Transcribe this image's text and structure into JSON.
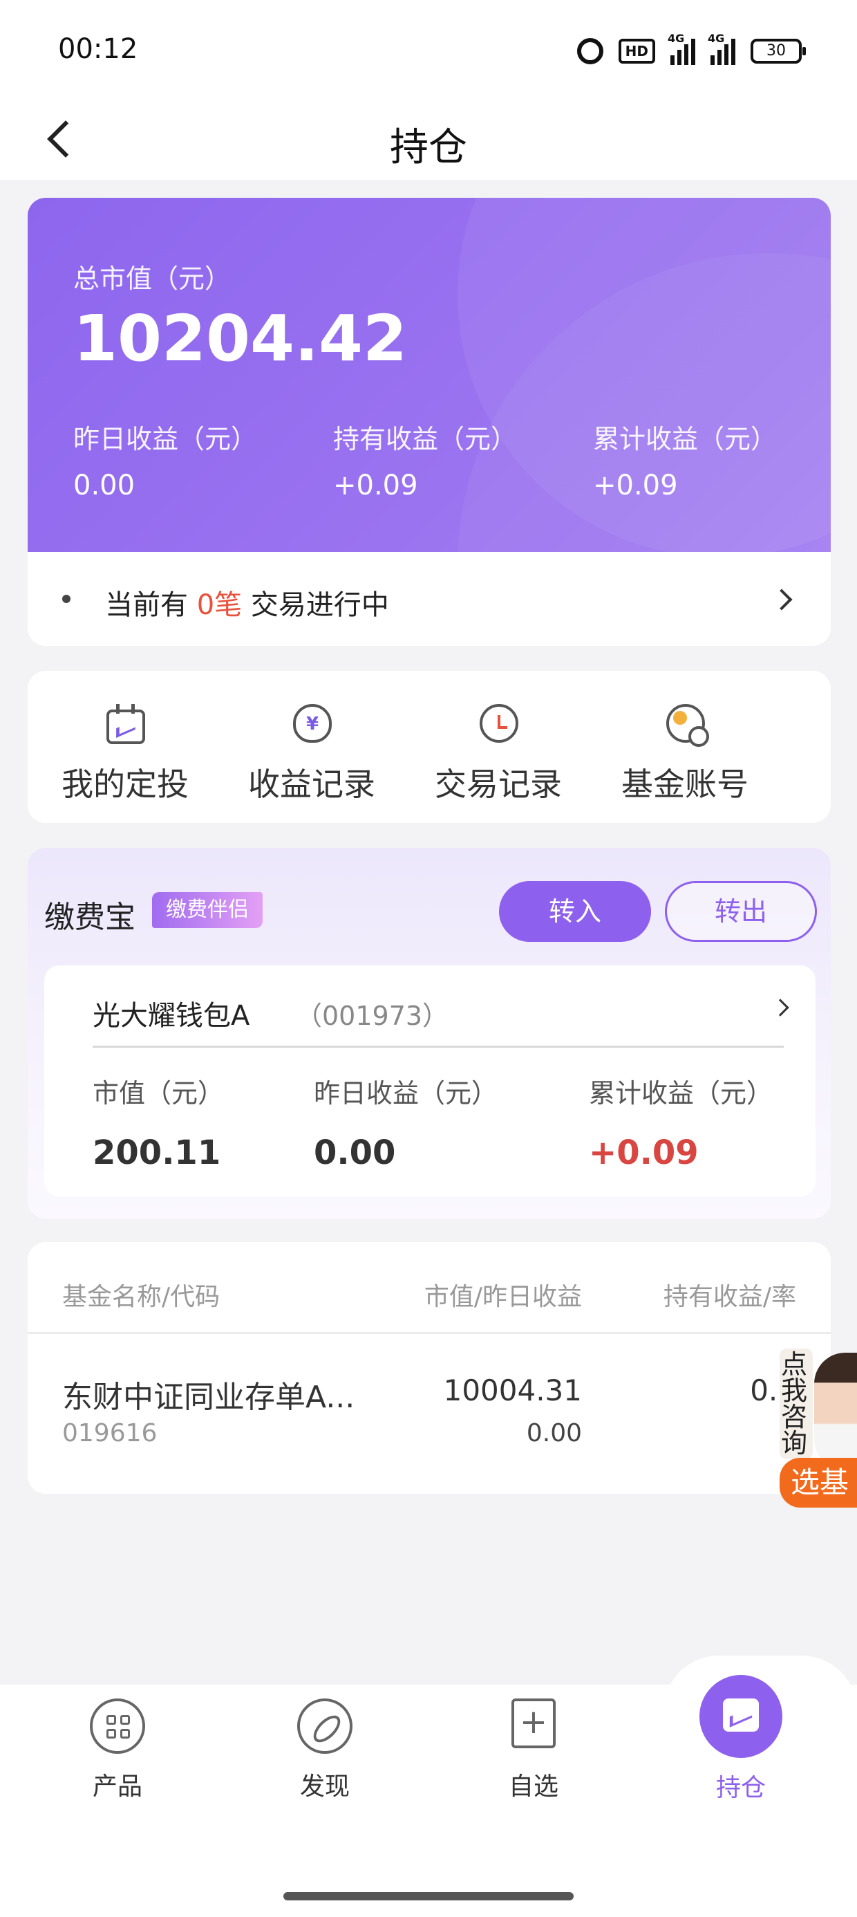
{
  "status_bar": {
    "time": "00:12",
    "hd": "HD",
    "net1": "4G",
    "net2": "4G",
    "battery": "30"
  },
  "header": {
    "title": "持仓"
  },
  "summary": {
    "total_label": "总市值（元）",
    "total_value": "10204.42",
    "metrics": [
      {
        "label": "昨日收益（元）",
        "value": "0.00"
      },
      {
        "label": "持有收益（元）",
        "value": "+0.09"
      },
      {
        "label": "累计收益（元）",
        "value": "+0.09"
      }
    ],
    "pending_prefix": "当前有",
    "pending_count": "0笔",
    "pending_suffix": "交易进行中"
  },
  "shortcuts": [
    {
      "label": "我的定投",
      "icon": "calendar-chart-icon"
    },
    {
      "label": "收益记录",
      "icon": "money-bag-icon"
    },
    {
      "label": "交易记录",
      "icon": "clock-history-icon"
    },
    {
      "label": "基金账号",
      "icon": "account-search-icon"
    }
  ],
  "payment": {
    "title": "缴费宝",
    "tag": "缴费伴侣",
    "btn_in": "转入",
    "btn_out": "转出",
    "fund_name": "光大耀钱包A",
    "fund_code": "（001973）",
    "metrics": [
      {
        "label": "市值（元）",
        "value": "200.11"
      },
      {
        "label": "昨日收益（元）",
        "value": "0.00"
      },
      {
        "label": "累计收益（元）",
        "value": "+0.09"
      }
    ]
  },
  "holdings": {
    "headers": {
      "name": "基金名称/代码",
      "mv": "市值/昨日收益",
      "hold": "持有收益/率"
    },
    "rows": [
      {
        "name": "东财中证同业存单A...",
        "code": "019616",
        "market_value": "10004.31",
        "yesterday": "0.00",
        "hold_income": "0.0"
      }
    ]
  },
  "consult": {
    "text": "点我咨询",
    "button": "选基"
  },
  "tabbar": [
    {
      "label": "产品",
      "icon": "grid-icon"
    },
    {
      "label": "发现",
      "icon": "compass-icon"
    },
    {
      "label": "自选",
      "icon": "add-bookmark-icon"
    },
    {
      "label": "持仓",
      "icon": "holdings-chart-icon",
      "active": true
    }
  ],
  "colors": {
    "accent": "#8e60ee",
    "red": "#d94540",
    "orange": "#f26a1b"
  }
}
